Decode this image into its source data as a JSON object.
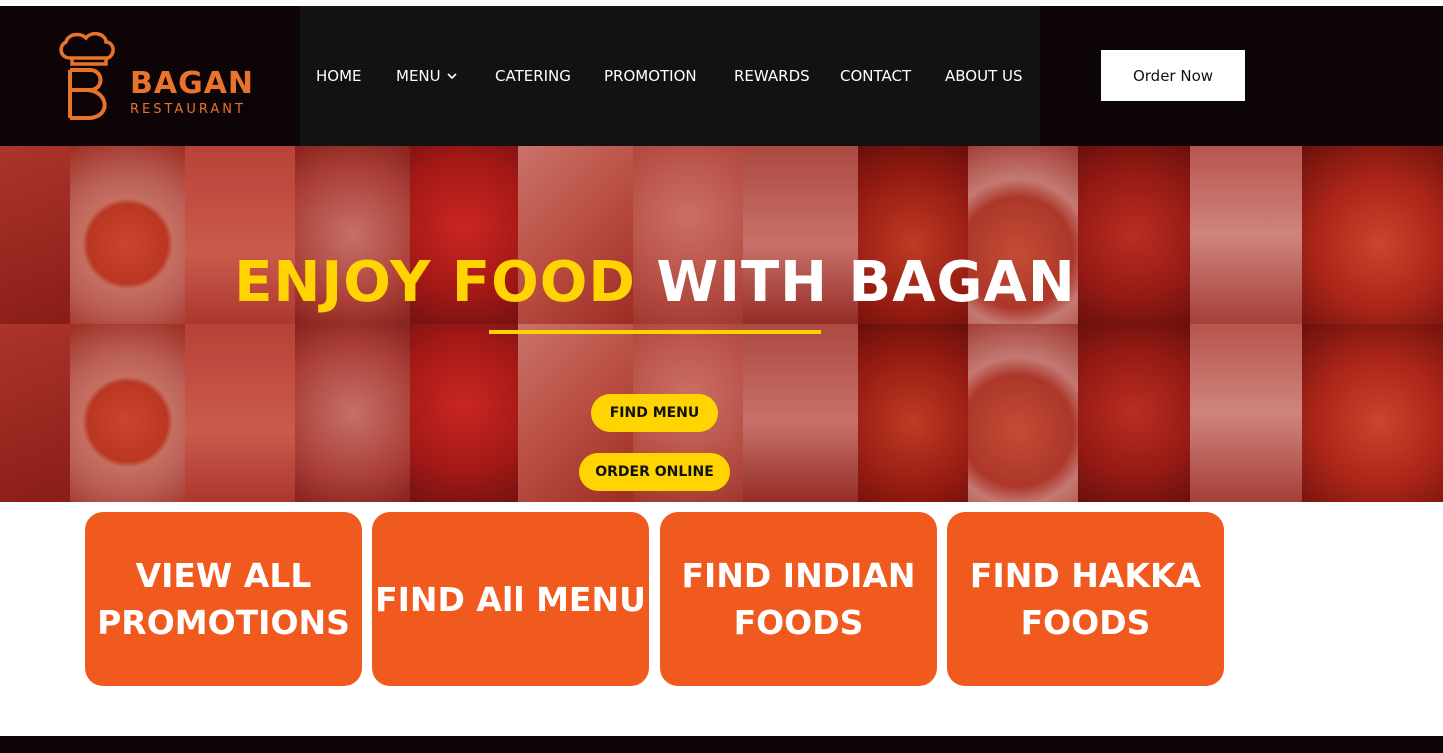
{
  "brand": {
    "name": "BAGAN",
    "sub": "RESTAURANT",
    "accent_color": "#e8732b"
  },
  "nav": {
    "items": [
      {
        "label": "HOME"
      },
      {
        "label": "MENU",
        "has_dropdown": true
      },
      {
        "label": "CATERING"
      },
      {
        "label": "PROMOTION"
      },
      {
        "label": "REWARDS"
      },
      {
        "label": "CONTACT"
      },
      {
        "label": "ABOUT US"
      }
    ],
    "order_button": "Order Now"
  },
  "hero": {
    "title_highlight": "ENJOY FOOD",
    "title_rest": "WITH BAGAN",
    "highlight_color": "#ffd400",
    "buttons": {
      "find_menu": "FIND MENU",
      "order_online": "ORDER ONLINE"
    }
  },
  "cards": [
    {
      "line1": "VIEW ALL",
      "line2": "PROMOTIONS"
    },
    {
      "line1": "FIND All MENU",
      "line2": ""
    },
    {
      "line1": "FIND INDIAN",
      "line2": "FOODS"
    },
    {
      "line1": "FIND HAKKA",
      "line2": "FOODS"
    }
  ],
  "colors": {
    "card_bg": "#f05a1e",
    "header_bg": "#0c0406",
    "nav_bg": "#121212"
  }
}
